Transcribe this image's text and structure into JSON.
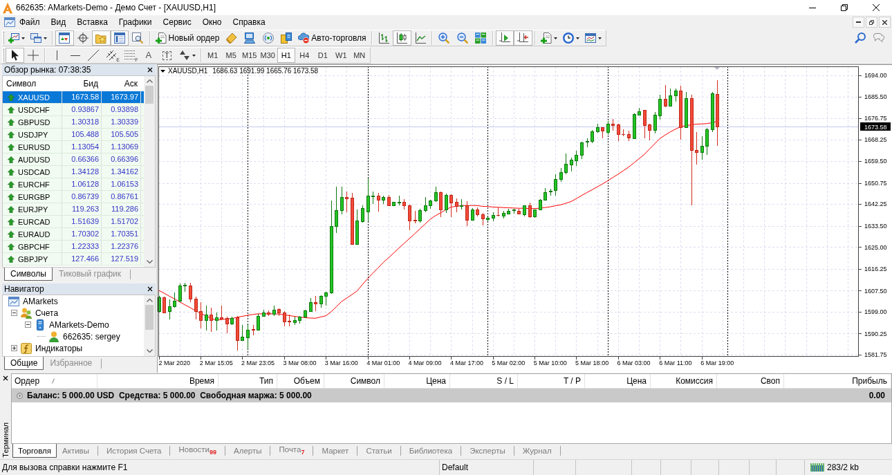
{
  "window": {
    "title": "662635: AMarkets-Demo - Демо Счет - [XAUUSD,H1]"
  },
  "menu": [
    "Файл",
    "Вид",
    "Вставка",
    "Графики",
    "Сервис",
    "Окно",
    "Справка"
  ],
  "toolbar_main": [
    {
      "on": false
    },
    {
      "on": false
    },
    {
      "on": true
    },
    {
      "on": false
    },
    {
      "on": true
    },
    {
      "on": true
    },
    {
      "on": false
    },
    {
      "label": "Новый ордер",
      "on": false
    },
    {
      "on": false
    },
    {
      "on": false
    },
    {
      "on": false
    },
    {
      "on": false
    },
    {
      "label": "Авто-торговля",
      "on": false
    },
    {
      "on": false
    },
    {
      "on": true
    },
    {
      "on": false
    },
    {
      "on": false
    },
    {
      "on": false
    },
    {
      "on": false
    },
    {
      "on": true
    },
    {
      "on": true
    },
    {
      "on": false
    },
    {
      "on": false
    },
    {
      "on": false
    }
  ],
  "toolbar_tools": [
    {
      "on": true
    },
    {
      "on": false
    },
    {
      "on": false
    },
    {
      "on": false
    },
    {
      "on": false
    },
    {
      "on": false,
      "sub": "E"
    },
    {
      "on": false,
      "sub": "F"
    },
    {
      "on": false,
      "glyph": "A"
    },
    {
      "on": false,
      "glyph": "T"
    },
    {
      "on": false
    }
  ],
  "timeframes": [
    {
      "label": "M1",
      "selected": false
    },
    {
      "label": "M5",
      "selected": false
    },
    {
      "label": "M15",
      "selected": false
    },
    {
      "label": "M30",
      "selected": false
    },
    {
      "label": "H1",
      "selected": true
    },
    {
      "label": "H4",
      "selected": false
    },
    {
      "label": "D1",
      "selected": false
    },
    {
      "label": "W1",
      "selected": false
    },
    {
      "label": "MN",
      "selected": false
    }
  ],
  "market_watch": {
    "title": "Обзор рынка: 07:38:35",
    "columns": [
      "Символ",
      "Бид",
      "Аск"
    ],
    "rows": [
      {
        "symbol": "XAUUSD",
        "bid": "1673.58",
        "ask": "1673.97",
        "rising": true,
        "selected": true
      },
      {
        "symbol": "USDCHF",
        "bid": "0.93867",
        "ask": "0.93898",
        "rising": true,
        "selected": false
      },
      {
        "symbol": "GBPUSD",
        "bid": "1.30318",
        "ask": "1.30339",
        "rising": true,
        "selected": false
      },
      {
        "symbol": "USDJPY",
        "bid": "105.488",
        "ask": "105.505",
        "rising": true,
        "selected": false
      },
      {
        "symbol": "EURUSD",
        "bid": "1.13054",
        "ask": "1.13069",
        "rising": true,
        "selected": false
      },
      {
        "symbol": "AUDUSD",
        "bid": "0.66366",
        "ask": "0.66396",
        "rising": true,
        "selected": false
      },
      {
        "symbol": "USDCAD",
        "bid": "1.34128",
        "ask": "1.34162",
        "rising": true,
        "selected": false
      },
      {
        "symbol": "EURCHF",
        "bid": "1.06128",
        "ask": "1.06153",
        "rising": true,
        "selected": false
      },
      {
        "symbol": "EURGBP",
        "bid": "0.86739",
        "ask": "0.86761",
        "rising": true,
        "selected": false
      },
      {
        "symbol": "EURJPY",
        "bid": "119.263",
        "ask": "119.286",
        "rising": true,
        "selected": false
      },
      {
        "symbol": "EURCAD",
        "bid": "1.51639",
        "ask": "1.51702",
        "rising": true,
        "selected": false
      },
      {
        "symbol": "EURAUD",
        "bid": "1.70302",
        "ask": "1.70351",
        "rising": true,
        "selected": false
      },
      {
        "symbol": "GBPCHF",
        "bid": "1.22333",
        "ask": "1.22376",
        "rising": true,
        "selected": false
      },
      {
        "symbol": "GBPJPY",
        "bid": "127.466",
        "ask": "127.519",
        "rising": true,
        "selected": false
      }
    ],
    "tabs": [
      {
        "label": "Символы",
        "selected": true
      },
      {
        "label": "Тиковый график",
        "selected": false
      }
    ]
  },
  "navigator": {
    "title": "Навигатор",
    "tree": [
      {
        "label": "AMarkets",
        "children": [
          {
            "label": "Счета",
            "expanded": true,
            "children": [
              {
                "label": "AMarkets-Demo",
                "expanded": true,
                "children": [
                  {
                    "label": "662635: sergey"
                  }
                ]
              }
            ]
          },
          {
            "label": "Индикаторы",
            "expanded": false
          }
        ]
      }
    ],
    "tabs": [
      {
        "label": "Общие",
        "selected": true
      },
      {
        "label": "Избранное",
        "selected": false
      }
    ]
  },
  "chart": {
    "chart_data": [
      {
        "type": "candlestick",
        "title": "XAUUSD,H1",
        "subtitle": "1686.63 1691.99 1665.76 1673.58",
        "categories": [
          null,
          null,
          null,
          "2 Mar 2020",
          null,
          null,
          null,
          null,
          null,
          null,
          null,
          "2 Mar 15:05",
          null,
          null,
          null,
          null,
          null,
          null,
          null,
          "2 Mar 23:05",
          null,
          null,
          null,
          null,
          null,
          null,
          null,
          "3 Mar 08:00",
          null,
          null,
          null,
          null,
          null,
          null,
          null,
          "3 Mar 16:00",
          null,
          null,
          null,
          null,
          null,
          null,
          null,
          "4 Mar 01:00",
          null,
          null,
          null,
          null,
          null,
          null,
          null,
          "4 Mar 09:00",
          null,
          null,
          null,
          null,
          null,
          null,
          null,
          "4 Mar 17:00",
          null,
          null,
          null,
          null,
          null,
          null,
          null,
          "5 Mar 02:00",
          null,
          null,
          null,
          null,
          null,
          null,
          null,
          "5 Mar 10:00",
          null,
          null,
          null,
          null,
          null,
          null,
          null,
          "5 Mar 18:00",
          null,
          null,
          null,
          null,
          null,
          null,
          null,
          "6 Mar 03:00",
          null,
          null,
          null,
          null,
          null,
          null,
          null,
          "6 Mar 11:00",
          null,
          null,
          null,
          null,
          null,
          null,
          null,
          "6 Mar 19:00",
          null,
          null,
          null,
          null,
          null,
          null,
          null,
          null,
          null,
          null,
          null,
          null,
          null,
          null,
          null,
          null,
          null,
          null,
          null,
          null,
          null,
          null,
          null,
          null,
          null,
          null
        ],
        "ylim": [
          1580.94,
          1697.61
        ],
        "yticks": [
          {
            "value": 1694,
            "label": "1694.00"
          },
          {
            "value": 1685.5,
            "label": "1685.50"
          },
          {
            "value": 1676.75,
            "label": "1676.75"
          },
          {
            "value": 1668.25,
            "label": "1668.25"
          },
          {
            "value": 1659.5,
            "label": "1659.50"
          },
          {
            "value": 1650.75,
            "label": "1650.75"
          },
          {
            "value": 1642.25,
            "label": "1642.25"
          },
          {
            "value": 1633.5,
            "label": "1633.50"
          },
          {
            "value": 1625,
            "label": "1625.00"
          },
          {
            "value": 1616.25,
            "label": "1616.25"
          },
          {
            "value": 1607.5,
            "label": "1607.50"
          },
          {
            "value": 1599,
            "label": "1599.00"
          },
          {
            "value": 1590.25,
            "label": "1590.25"
          },
          {
            "value": 1581.75,
            "label": "1581.75"
          }
        ],
        "grid": true,
        "series": [
          {
            "type": "line",
            "color": "#ff0000",
            "values": [
              1607.6,
              1606.5,
              1605.3,
              1604.2,
              1603.0,
              1601.8,
              1600.7,
              1599.5,
              1598.4,
              1597.4,
              1596.4,
              1595.6,
              1595.9,
              1596.1,
              1596.3,
              1596.8,
              1597.2,
              1597.6,
              1597.9,
              1598.2,
              1598.2,
              1598.2,
              1598.2,
              1598.1,
              1597.8,
              1597.5,
              1597.2,
              1596.9,
              1596.7,
              1596.5,
              1596.4,
              1596.9,
              1597.4,
              1599.0,
              1601.0,
              1603.1,
              1604.5,
              1605.9,
              1607.4,
              1609.9,
              1612.3,
              1614.5,
              1616.6,
              1618.8,
              1620.7,
              1622.6,
              1624.6,
              1626.5,
              1628.4,
              1630.3,
              1632.3,
              1634.2,
              1636.2,
              1637.6,
              1638.8,
              1640.0,
              1641.1,
              1641.4,
              1641.7,
              1641.7,
              1641.7,
              1641.7,
              1641.4,
              1641.3,
              1641.1,
              1641.0,
              1640.9,
              1640.8,
              1640.7,
              1640.6,
              1640.6,
              1640.5,
              1640.5,
              1640.6,
              1640.9,
              1641.2,
              1641.6,
              1642.0,
              1642.6,
              1643.3,
              1644.5,
              1645.7,
              1646.9,
              1648.0,
              1649.2,
              1650.4,
              1651.6,
              1653.0,
              1654.3,
              1655.7,
              1657.1,
              1658.8,
              1660.5,
              1662.2,
              1664.4,
              1666.5,
              1668.6,
              1670.0,
              1671.3,
              1672.4,
              1673.4,
              1673.8,
              1674.1,
              1674.4,
              1674.5,
              1674.6,
              1675.0,
              1675.5,
              null,
              null,
              null,
              null,
              null,
              null,
              null,
              null,
              null,
              null,
              null,
              null,
              null,
              null,
              null,
              null,
              null,
              null,
              null,
              null,
              null,
              null,
              null,
              null,
              null,
              null
            ]
          },
          {
            "type": "candlestick",
            "ohlc": [
              [
                1599.3,
                1605.3,
                1598.8,
                1604.8
              ],
              [
                1604.8,
                1605.2,
                1598.4,
                1598.8
              ],
              [
                1599.3,
                1603.9,
                1596.0,
                1601.1
              ],
              [
                1601.1,
                1606.7,
                1600.6,
                1603.4
              ],
              [
                1603.4,
                1610.4,
                1603.0,
                1609.5
              ],
              [
                1609.5,
                1610.8,
                1607.1,
                1609.9
              ],
              [
                1609.6,
                1610.7,
                1603.0,
                1604.4
              ],
              [
                1604.4,
                1605.0,
                1596.0,
                1599.3
              ],
              [
                1599.3,
                1603.0,
                1592.3,
                1595.8
              ],
              [
                1595.8,
                1601.6,
                1591.4,
                1597.9
              ],
              [
                1597.9,
                1600.7,
                1590.9,
                1595.6
              ],
              [
                1595.6,
                1598.8,
                1591.4,
                1596.7
              ],
              [
                1596.7,
                1601.6,
                1596.0,
                1596.2
              ],
              [
                1596.5,
                1597.0,
                1590.5,
                1594.2
              ],
              [
                1594.2,
                1597.0,
                1593.8,
                1596.5
              ],
              [
                1596.7,
                1597.2,
                1583.5,
                1587.7
              ],
              [
                1587.7,
                1593.7,
                1587.3,
                1589.1
              ],
              [
                1588.6,
                1593.7,
                1584.0,
                1591.9
              ],
              [
                1592.0,
                1593.7,
                1589.6,
                1591.7
              ],
              [
                1591.9,
                1598.3,
                1591.4,
                1597.4
              ],
              [
                1597.4,
                1599.7,
                1597.0,
                1598.8
              ],
              [
                1598.8,
                1599.5,
                1597.4,
                1598.1
              ],
              [
                1598.1,
                1601.6,
                1597.4,
                1599.9
              ],
              [
                1600.2,
                1600.5,
                1597.4,
                1598.8
              ],
              [
                1598.8,
                1599.3,
                1593.2,
                1595.1
              ],
              [
                1595.3,
                1597.9,
                1593.2,
                1595.1
              ],
              [
                1594.8,
                1597.0,
                1593.7,
                1595.8
              ],
              [
                1595.8,
                1597.4,
                1594.2,
                1597.0
              ],
              [
                1597.0,
                1599.8,
                1596.5,
                1599.5
              ],
              [
                1599.3,
                1604.6,
                1599.0,
                1602.8
              ],
              [
                1602.8,
                1605.3,
                1599.3,
                1602.2
              ],
              [
                1602.2,
                1605.8,
                1600.6,
                1605.3
              ],
              [
                1605.3,
                1607.1,
                1601.6,
                1606.7
              ],
              [
                1606.7,
                1643.7,
                1606.2,
                1633.5
              ],
              [
                1633.4,
                1649.3,
                1630.8,
                1639.7
              ],
              [
                1639.7,
                1649.3,
                1638.2,
                1645.1
              ],
              [
                1645.1,
                1647.4,
                1639.1,
                1644.6
              ],
              [
                1644.8,
                1646.7,
                1626.3,
                1626.3
              ],
              [
                1626.3,
                1640.2,
                1626.3,
                1635.6
              ],
              [
                1635.4,
                1641.9,
                1634.9,
                1640.7
              ],
              [
                1639.3,
                1652.5,
                1635.4,
                1645.6
              ],
              [
                1645.4,
                1647.4,
                1642.3,
                1645.6
              ],
              [
                1645.6,
                1646.7,
                1639.3,
                1643.9
              ],
              [
                1643.9,
                1645.8,
                1642.3,
                1645.0
              ],
              [
                1645.0,
                1646.0,
                1641.4,
                1641.9
              ],
              [
                1641.9,
                1643.2,
                1641.4,
                1643.1
              ],
              [
                1642.9,
                1645.6,
                1641.9,
                1643.2
              ],
              [
                1643.2,
                1644.2,
                1640.0,
                1641.9
              ],
              [
                1641.9,
                1642.0,
                1631.7,
                1635.8
              ],
              [
                1636.0,
                1639.6,
                1634.5,
                1635.6
              ],
              [
                1635.6,
                1640.5,
                1634.9,
                1639.7
              ],
              [
                1639.7,
                1645.1,
                1639.1,
                1641.7
              ],
              [
                1641.7,
                1644.0,
                1640.5,
                1643.7
              ],
              [
                1643.7,
                1649.3,
                1643.2,
                1647.1
              ],
              [
                1647.1,
                1647.4,
                1637.1,
                1640.2
              ],
              [
                1640.2,
                1646.5,
                1638.6,
                1646.0
              ],
              [
                1646.0,
                1646.3,
                1637.1,
                1642.8
              ],
              [
                1643.1,
                1644.5,
                1638.9,
                1641.4
              ],
              [
                1641.4,
                1644.2,
                1640.2,
                1641.9
              ],
              [
                1641.9,
                1643.4,
                1633.4,
                1636.0
              ],
              [
                1636.0,
                1640.8,
                1635.6,
                1640.2
              ],
              [
                1640.2,
                1641.0,
                1637.2,
                1638.2
              ],
              [
                1638.2,
                1638.6,
                1633.7,
                1636.5
              ],
              [
                1636.1,
                1637.0,
                1635.4,
                1636.8
              ],
              [
                1636.8,
                1638.9,
                1635.4,
                1638.0
              ],
              [
                1638.0,
                1640.9,
                1637.2,
                1637.8
              ],
              [
                1637.7,
                1639.5,
                1636.5,
                1638.6
              ],
              [
                1638.4,
                1640.5,
                1638.2,
                1639.6
              ],
              [
                1639.8,
                1640.5,
                1638.4,
                1640.1
              ],
              [
                1639.6,
                1640.5,
                1638.1,
                1638.4
              ],
              [
                1638.3,
                1641.9,
                1637.2,
                1641.7
              ],
              [
                1641.7,
                1642.8,
                1636.8,
                1637.2
              ],
              [
                1637.2,
                1640.2,
                1636.9,
                1640.0
              ],
              [
                1640.0,
                1644.3,
                1639.8,
                1644.0
              ],
              [
                1643.9,
                1648.8,
                1643.7,
                1647.1
              ],
              [
                1647.4,
                1648.5,
                1645.6,
                1647.6
              ],
              [
                1647.9,
                1654.4,
                1645.8,
                1652.4
              ],
              [
                1652.2,
                1656.7,
                1651.1,
                1655.0
              ],
              [
                1655.0,
                1662.7,
                1654.4,
                1658.5
              ],
              [
                1658.3,
                1660.9,
                1655.3,
                1660.1
              ],
              [
                1659.9,
                1663.6,
                1657.6,
                1662.0
              ],
              [
                1662.1,
                1667.3,
                1660.4,
                1667.1
              ],
              [
                1667.2,
                1668.7,
                1665.0,
                1667.5
              ],
              [
                1667.5,
                1672.0,
                1666.9,
                1671.5
              ],
              [
                1671.5,
                1674.5,
                1671.0,
                1673.1
              ],
              [
                1673.2,
                1673.3,
                1668.7,
                1671.9
              ],
              [
                1671.3,
                1675.7,
                1670.1,
                1674.5
              ],
              [
                1674.5,
                1676.6,
                1671.7,
                1674.1
              ],
              [
                1674.3,
                1674.5,
                1667.6,
                1670.4
              ],
              [
                1670.5,
                1672.4,
                1669.6,
                1670.3
              ],
              [
                1670.5,
                1671.7,
                1667.6,
                1668.9
              ],
              [
                1668.7,
                1678.6,
                1668.7,
                1678.4
              ],
              [
                1678.3,
                1681.0,
                1678.0,
                1679.6
              ],
              [
                1680.0,
                1680.2,
                1668.7,
                1674.1
              ],
              [
                1674.3,
                1674.5,
                1667.8,
                1672.0
              ],
              [
                1672.0,
                1679.4,
                1670.6,
                1678.2
              ],
              [
                1678.0,
                1686.1,
                1676.3,
                1684.5
              ],
              [
                1684.5,
                1690.0,
                1681.2,
                1681.9
              ],
              [
                1681.9,
                1688.6,
                1681.7,
                1686.0
              ],
              [
                1686.0,
                1688.6,
                1683.5,
                1688.0
              ],
              [
                1687.9,
                1689.8,
                1668.3,
                1673.3
              ],
              [
                1673.3,
                1687.2,
                1672.9,
                1684.9
              ],
              [
                1684.9,
                1686.3,
                1641.9,
                1663.9
              ],
              [
                1663.9,
                1671.3,
                1658.1,
                1663.3
              ],
              [
                1663.3,
                1669.5,
                1660.2,
                1665.8
              ],
              [
                1665.8,
                1672.9,
                1662.0,
                1672.2
              ],
              [
                1672.2,
                1687.2,
                1671.3,
                1686.8
              ],
              [
                1686.63,
                1691.99,
                1665.76,
                1673.58
              ],
              null,
              null,
              null,
              null,
              null,
              null,
              null,
              null,
              null,
              null,
              null,
              null,
              null,
              null,
              null,
              null,
              null,
              null,
              null,
              null,
              null,
              null,
              null,
              null,
              null,
              null
            ]
          }
        ],
        "ref_lines": [
          {
            "axis": "y",
            "value": 1673.58,
            "label": "1673.58",
            "color": "#c8c8f0"
          }
        ]
      }
    ]
  },
  "terminal": {
    "title": "Терминал",
    "columns": [
      "Ордер",
      "Время",
      "Тип",
      "Объем",
      "Символ",
      "Цена",
      "S / L",
      "T / P",
      "Цена",
      "Комиссия",
      "Своп",
      "Прибыль"
    ],
    "balance": {
      "summary": "Баланс: 5 000.00 USD  Средства: 5 000.00  Свободная маржа: 5 000.00",
      "profit": "0.00"
    },
    "tabs": [
      {
        "label": "Торговля",
        "selected": true
      },
      {
        "label": "Активы",
        "selected": false
      },
      {
        "label": "История Счета",
        "selected": false
      },
      {
        "label": "Новости",
        "badge": "99",
        "selected": false
      },
      {
        "label": "Алерты",
        "selected": false
      },
      {
        "label": "Почта",
        "badge": "7",
        "selected": false
      },
      {
        "label": "Маркет",
        "selected": false
      },
      {
        "label": "Статьи",
        "selected": false
      },
      {
        "label": "Библиотека",
        "selected": false
      },
      {
        "label": "Эксперты",
        "selected": false
      },
      {
        "label": "Журнал",
        "selected": false
      }
    ]
  },
  "status_bar": {
    "help": "Для вызова справки нажмите F1",
    "profile": "Default",
    "traffic": "283/2 kb"
  }
}
